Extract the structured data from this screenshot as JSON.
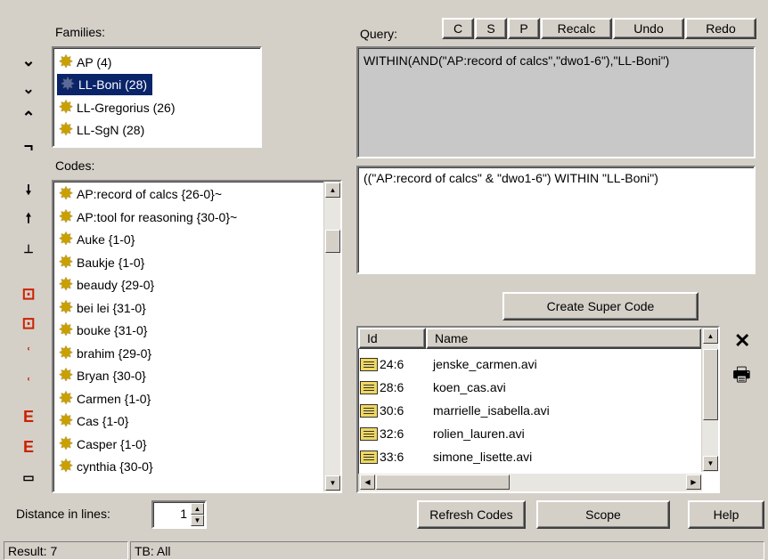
{
  "families_label": "Families:",
  "codes_label": "Codes:",
  "query_label": "Query:",
  "families": [
    {
      "label": "AP (4)"
    },
    {
      "label": "LL-Boni (28)",
      "selected": true
    },
    {
      "label": "LL-Gregorius (26)"
    },
    {
      "label": "LL-SgN (28)"
    }
  ],
  "codes": [
    "AP:record of calcs {26-0}~",
    "AP:tool for reasoning {30-0}~",
    "Auke {1-0}",
    "Baukje {1-0}",
    "beaudy {29-0}",
    "bei lei {31-0}",
    "bouke {31-0}",
    "brahim {29-0}",
    "Bryan {30-0}",
    "Carmen {1-0}",
    "Cas {1-0}",
    "Casper {1-0}",
    "cynthia {30-0}"
  ],
  "query_buttons": [
    "C",
    "S",
    "P",
    "Recalc",
    "Undo",
    "Redo"
  ],
  "query_text": "WITHIN(AND(\"AP:record of calcs\",\"dwo1-6\"),\"LL-Boni\")",
  "query_expression": "((\"AP:record of calcs\" & \"dwo1-6\") WITHIN \"LL-Boni\")",
  "create_super_code": "Create Super Code",
  "results_columns": {
    "id": "Id",
    "name": "Name"
  },
  "results": [
    {
      "id": "24:6",
      "name": "jenske_carmen.avi"
    },
    {
      "id": "28:6",
      "name": "koen_cas.avi"
    },
    {
      "id": "30:6",
      "name": "marrielle_isabella.avi"
    },
    {
      "id": "32:6",
      "name": "rolien_lauren.avi"
    },
    {
      "id": "33:6",
      "name": "simone_lisette.avi"
    }
  ],
  "distance_label": "Distance in lines:",
  "distance_value": "1",
  "refresh_codes": "Refresh Codes",
  "scope": "Scope",
  "help": "Help",
  "status_result": "Result: 7",
  "status_tb": "TB: All",
  "tool_icons": [
    "chevron-down-icon",
    "double-chevron-down-icon",
    "chevron-up-icon",
    "corner-icon",
    "arrow-down-icon",
    "arrow-up-icon",
    "tree-icon",
    "bracket-icon-1",
    "bracket-icon-2",
    "bracket-icon-3",
    "bracket-icon-4",
    "bracket-icon-5",
    "bracket-icon-6",
    "list-icon"
  ],
  "colors": {
    "selection": "#0a246a",
    "query_bg": "#c8c8c8",
    "window_bg": "#d4d0c8",
    "icon_red": "#cc2200"
  }
}
